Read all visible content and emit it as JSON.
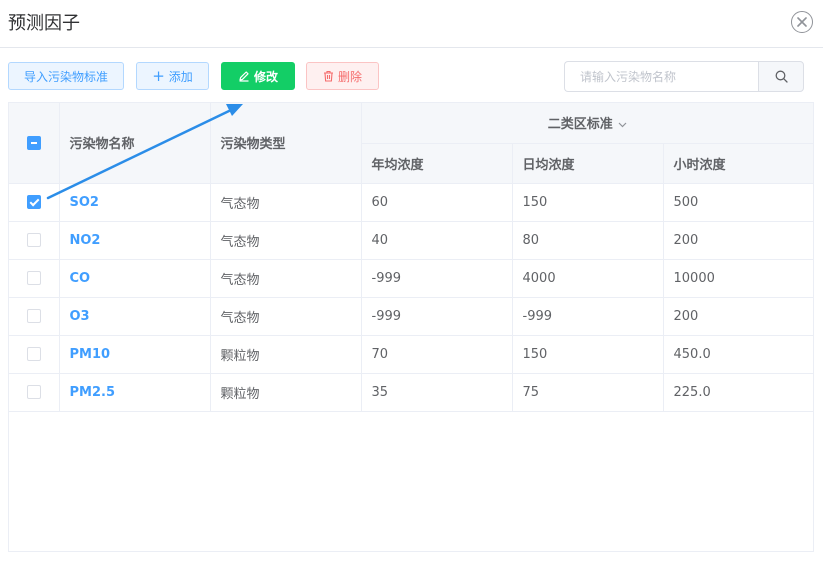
{
  "dialog": {
    "title": "预测因子"
  },
  "toolbar": {
    "import_label": "导入污染物标准",
    "add_label": "添加",
    "edit_label": "修改",
    "delete_label": "删除"
  },
  "search": {
    "placeholder": "请输入污染物名称",
    "value": ""
  },
  "table": {
    "headers": {
      "name": "污染物名称",
      "type": "污染物类型",
      "group": "二类区标准",
      "annual": "年均浓度",
      "daily": "日均浓度",
      "hourly": "小时浓度"
    },
    "rows": [
      {
        "name": "SO2",
        "type": "气态物",
        "annual": "60",
        "daily": "150",
        "hourly": "500",
        "checked": true
      },
      {
        "name": "NO2",
        "type": "气态物",
        "annual": "40",
        "daily": "80",
        "hourly": "200",
        "checked": false
      },
      {
        "name": "CO",
        "type": "气态物",
        "annual": "-999",
        "daily": "4000",
        "hourly": "10000",
        "checked": false
      },
      {
        "name": "O3",
        "type": "气态物",
        "annual": "-999",
        "daily": "-999",
        "hourly": "200",
        "checked": false
      },
      {
        "name": "PM10",
        "type": "颗粒物",
        "annual": "70",
        "daily": "150",
        "hourly": "450.0",
        "checked": false
      },
      {
        "name": "PM2.5",
        "type": "颗粒物",
        "annual": "35",
        "daily": "75",
        "hourly": "225.0",
        "checked": false
      }
    ]
  },
  "colors": {
    "primary": "#409eff",
    "success": "#13ce66",
    "danger": "#f56c6c",
    "annotation": "#2b8de8"
  }
}
